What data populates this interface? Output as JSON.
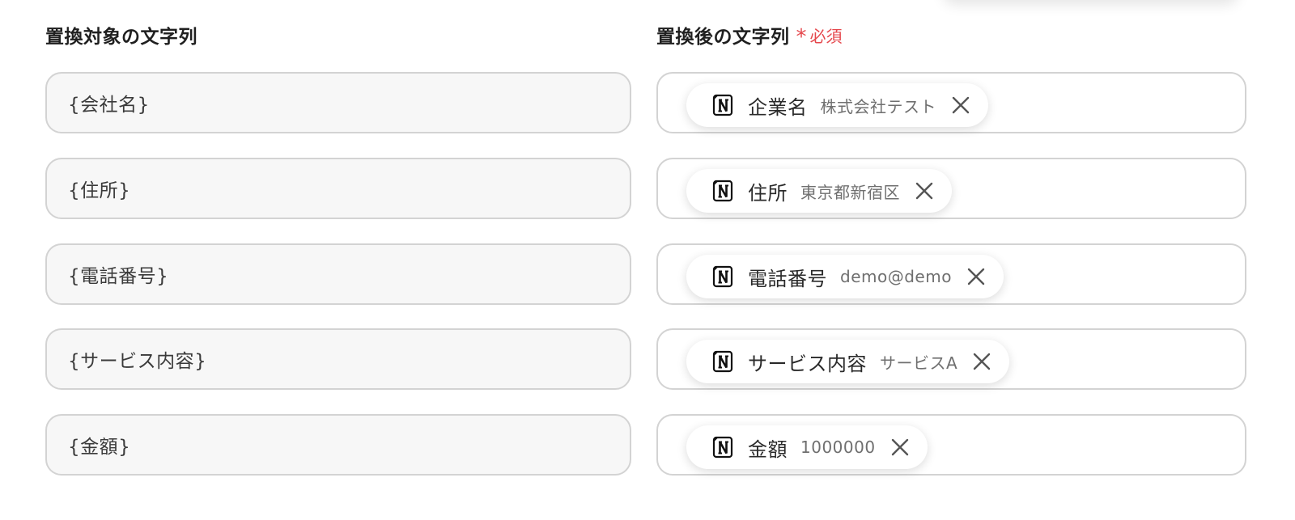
{
  "left_column": {
    "header": "置換対象の文字列",
    "fields": [
      {
        "value": "{会社名}"
      },
      {
        "value": "{住所}"
      },
      {
        "value": "{電話番号}"
      },
      {
        "value": "{サービス内容}"
      },
      {
        "value": "{金額}"
      }
    ]
  },
  "right_column": {
    "header": "置換後の文字列",
    "required_star": "*",
    "required_label": "必須",
    "required_color": "#e5484d",
    "chip_icon": "notion-icon",
    "remove_icon": "close-icon",
    "fields": [
      {
        "label": "企業名",
        "value": "株式会社テスト"
      },
      {
        "label": "住所",
        "value": "東京都新宿区"
      },
      {
        "label": "電話番号",
        "value": "demo@demo"
      },
      {
        "label": "サービス内容",
        "value": "サービスA"
      },
      {
        "label": "金額",
        "value": "1000000"
      }
    ]
  }
}
